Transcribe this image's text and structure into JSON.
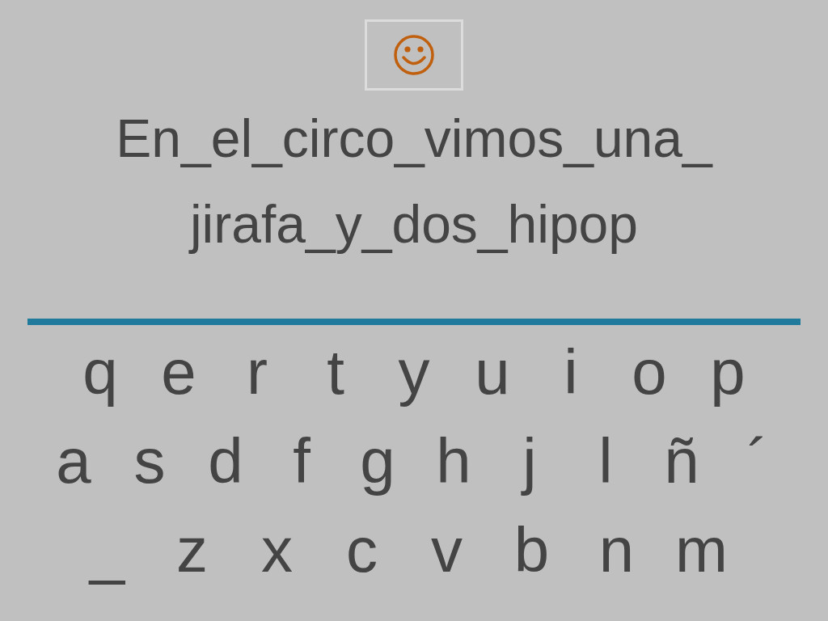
{
  "sentence_lines": [
    "En_el_circo_vimos_una_",
    "jirafa_y_dos_hipop"
  ],
  "keyboard_rows": [
    [
      "q",
      "e",
      "r",
      "t",
      "y",
      "u",
      "i",
      "o",
      "p"
    ],
    [
      "a",
      "s",
      "d",
      "f",
      "g",
      "h",
      "j",
      "l",
      "ñ",
      "´"
    ],
    [
      "_",
      "z",
      "x",
      "c",
      "v",
      "b",
      "n",
      "m"
    ]
  ]
}
